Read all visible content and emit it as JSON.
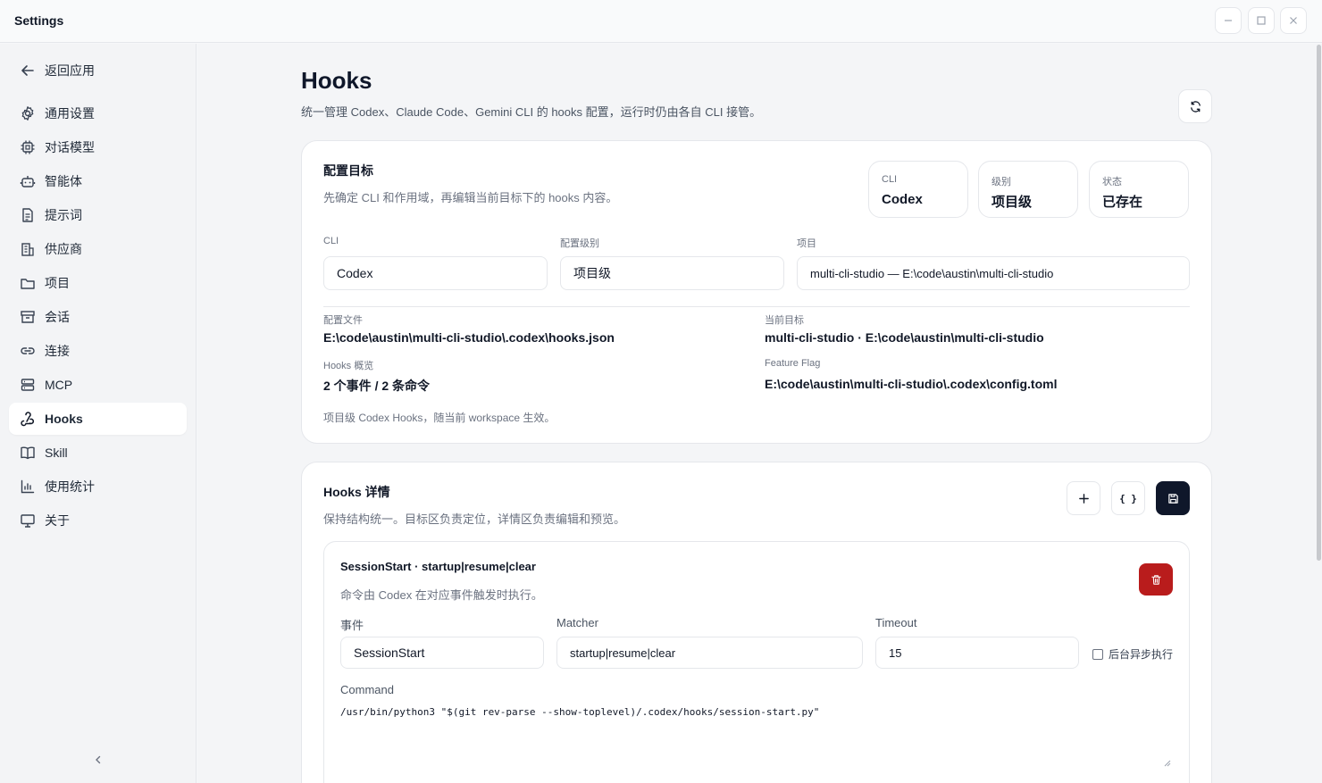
{
  "window": {
    "title": "Settings"
  },
  "sidebar": {
    "back_label": "返回应用",
    "items": [
      {
        "label": "通用设置",
        "icon": "gear-icon"
      },
      {
        "label": "对话模型",
        "icon": "cpu-icon"
      },
      {
        "label": "智能体",
        "icon": "bot-icon"
      },
      {
        "label": "提示词",
        "icon": "document-icon"
      },
      {
        "label": "供应商",
        "icon": "building-icon"
      },
      {
        "label": "项目",
        "icon": "folder-icon"
      },
      {
        "label": "会话",
        "icon": "archive-icon"
      },
      {
        "label": "连接",
        "icon": "link-icon"
      },
      {
        "label": "MCP",
        "icon": "server-icon"
      },
      {
        "label": "Hooks",
        "icon": "webhook-icon",
        "active": true
      },
      {
        "label": "Skill",
        "icon": "book-icon"
      },
      {
        "label": "使用统计",
        "icon": "chart-icon"
      },
      {
        "label": "关于",
        "icon": "monitor-icon"
      }
    ]
  },
  "header": {
    "title": "Hooks",
    "description": "统一管理 Codex、Claude Code、Gemini CLI 的 hooks 配置，运行时仍由各自 CLI 接管。"
  },
  "target": {
    "title": "配置目标",
    "subtitle": "先确定 CLI 和作用域，再编辑当前目标下的 hooks 内容。",
    "stats": [
      {
        "label": "CLI",
        "value": "Codex"
      },
      {
        "label": "级别",
        "value": "项目级"
      },
      {
        "label": "状态",
        "value": "已存在"
      }
    ],
    "fields": {
      "cli_label": "CLI",
      "cli_value": "Codex",
      "level_label": "配置级别",
      "level_value": "项目级",
      "project_label": "项目",
      "project_value": "multi-cli-studio — E:\\code\\austin\\multi-cli-studio"
    },
    "info": {
      "config_file_label": "配置文件",
      "config_file_value": "E:\\code\\austin\\multi-cli-studio\\.codex\\hooks.json",
      "current_target_label": "当前目标",
      "current_target_value": "multi-cli-studio · E:\\code\\austin\\multi-cli-studio",
      "overview_label": "Hooks 概览",
      "overview_value": "2 个事件 / 2 条命令",
      "feature_flag_label": "Feature Flag",
      "feature_flag_value": "E:\\code\\austin\\multi-cli-studio\\.codex\\config.toml"
    },
    "note": "项目级 Codex Hooks，随当前 workspace 生效。"
  },
  "details": {
    "title": "Hooks 详情",
    "subtitle": "保持结构统一。目标区负责定位，详情区负责编辑和预览。",
    "json_icon_text": "{ }",
    "hook": {
      "title": "SessionStart · startup|resume|clear",
      "subtitle": "命令由 Codex 在对应事件触发时执行。",
      "event_label": "事件",
      "event_value": "SessionStart",
      "matcher_label": "Matcher",
      "matcher_value": "startup|resume|clear",
      "timeout_label": "Timeout",
      "timeout_value": "15",
      "async_label": "后台异步执行",
      "command_label": "Command",
      "command_value": "/usr/bin/python3 \"$(git rev-parse --show-toplevel)/.codex/hooks/session-start.py\""
    }
  },
  "colors": {
    "danger": "#b91c1c",
    "primary_dark": "#0f172a"
  }
}
